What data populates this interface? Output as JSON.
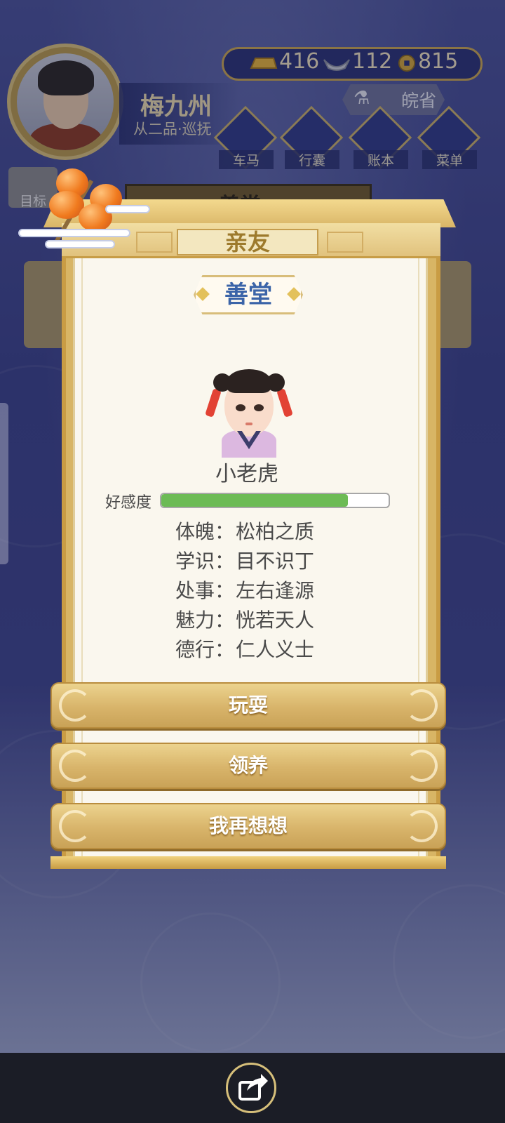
{
  "player": {
    "name": "梅九州",
    "rank": "从二品·巡抚"
  },
  "currency": {
    "gold": "416",
    "silver": "112",
    "coin": "815"
  },
  "location": {
    "province": "皖省"
  },
  "top_menu": [
    {
      "label": "车马",
      "icon": "carriage-icon"
    },
    {
      "label": "行囊",
      "icon": "bag-icon"
    },
    {
      "label": "账本",
      "icon": "ledger-icon"
    },
    {
      "label": "菜单",
      "icon": "more-icon"
    }
  ],
  "background": {
    "goal_label": "目标",
    "banner_label": "善堂"
  },
  "dialog": {
    "title": "亲友",
    "tag": "善堂",
    "child_name": "小老虎",
    "favor_label": "好感度",
    "favor_value": 0.82,
    "attributes": [
      {
        "key": "体魄",
        "sep": "：",
        "value": "松柏之质"
      },
      {
        "key": "学识",
        "sep": "：",
        "value": "目不识丁"
      },
      {
        "key": "处事",
        "sep": "：",
        "value": "左右逢源"
      },
      {
        "key": "魅力",
        "sep": "：",
        "value": "恍若天人"
      },
      {
        "key": "德行",
        "sep": "：",
        "value": "仁人义士"
      }
    ],
    "buttons": {
      "play": "玩耍",
      "adopt": "领养",
      "reconsider": "我再想想"
    }
  },
  "colors": {
    "title_gold": "#9d7a2c",
    "tag_blue": "#3b64a8",
    "favor_green": "#6cbb55",
    "button_gold": "#d8b46a"
  }
}
